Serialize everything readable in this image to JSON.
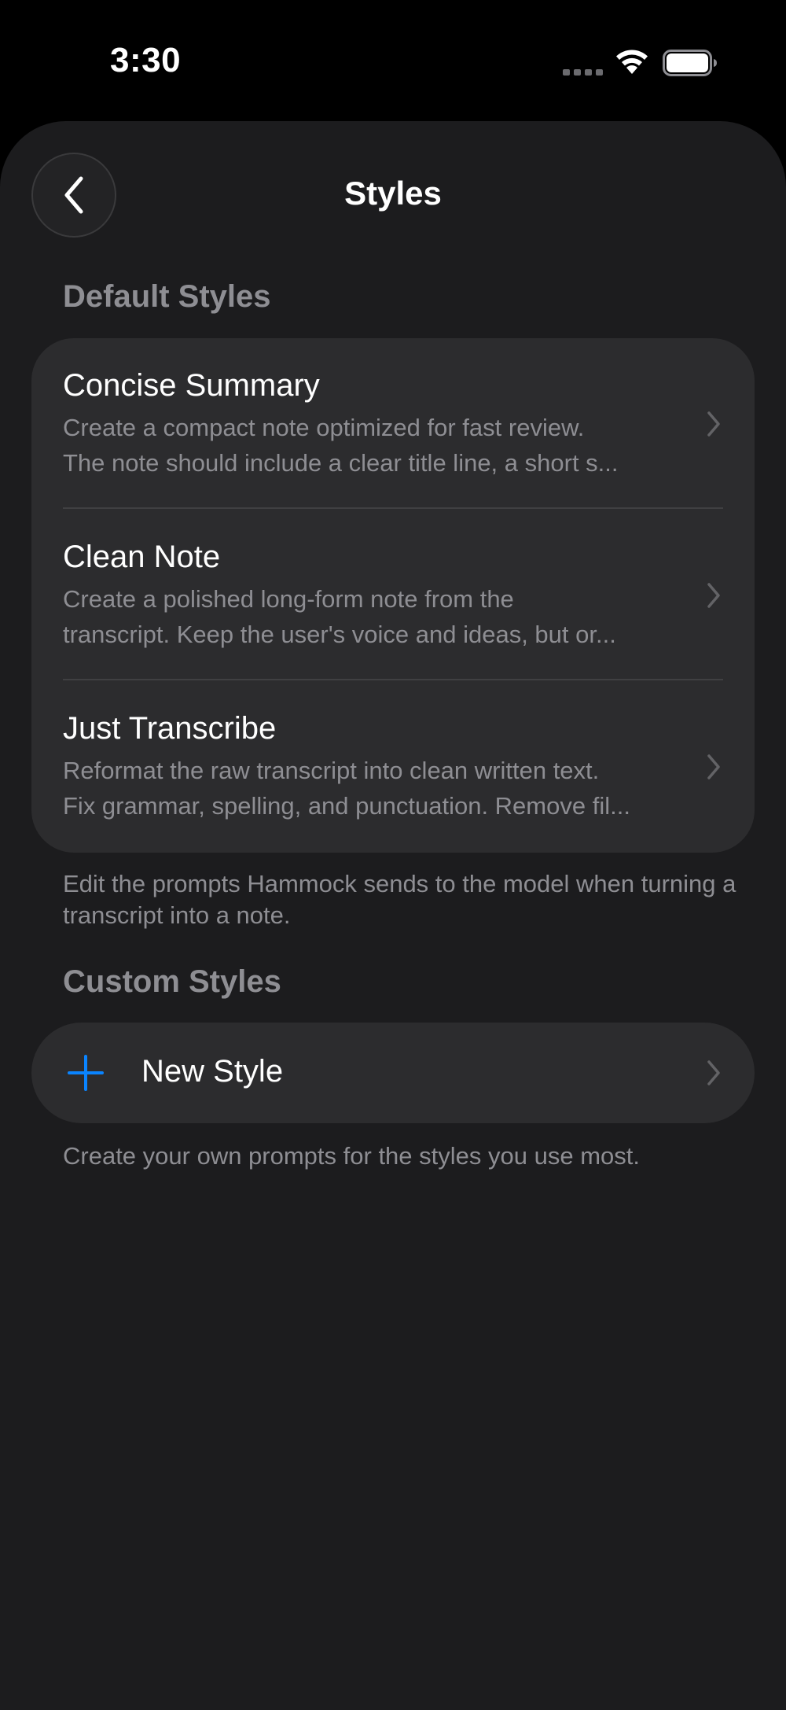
{
  "status_bar": {
    "time": "3:30"
  },
  "header": {
    "title": "Styles",
    "back_icon": "chevron-left-icon"
  },
  "default_section": {
    "header": "Default Styles",
    "items": [
      {
        "title": "Concise Summary",
        "desc_line1": "Create a compact note optimized for fast review.",
        "desc_line2": "The note should include a clear title line, a short s..."
      },
      {
        "title": "Clean Note",
        "desc_line1": "Create a polished long-form note from the",
        "desc_line2": "transcript. Keep the user's voice and ideas, but or..."
      },
      {
        "title": "Just Transcribe",
        "desc_line1": "Reformat the raw transcript into clean written text.",
        "desc_line2": "Fix grammar, spelling, and punctuation. Remove fil..."
      }
    ],
    "footnote": "Edit the prompts Hammock sends to the model when turning a transcript into a note."
  },
  "custom_section": {
    "header": "Custom Styles",
    "new_style_label": "New Style",
    "footnote": "Create your own prompts for the styles you use most."
  },
  "colors": {
    "background": "#000000",
    "sheet": "#1c1c1e",
    "card": "#2c2c2e",
    "secondary_text": "#8e8e93",
    "accent": "#0a84ff"
  }
}
